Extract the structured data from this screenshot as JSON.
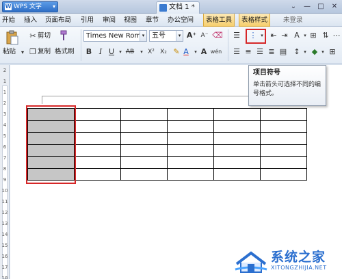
{
  "title_bar": {
    "app_name": "WPS 文字",
    "app_caret": "▾",
    "doc_tab": "文档 1 *",
    "controls": [
      "⌄",
      "—",
      "□",
      "✕"
    ]
  },
  "menu": {
    "items": [
      "开始",
      "插入",
      "页面布局",
      "引用",
      "审阅",
      "视图",
      "章节",
      "办公空间",
      "表格工具",
      "表格样式"
    ],
    "login": "未登录"
  },
  "toolbar": {
    "cut": "剪切",
    "paste": "粘贴",
    "copy": "复制",
    "format_painter": "格式刷",
    "font_name": "Times New Roma",
    "font_size": "五号",
    "bold": "B",
    "italic": "I",
    "underline": "U",
    "strike": "AB",
    "superscript": "X²",
    "subscript": "X₂",
    "font_color": "A",
    "grow_font": "A⁺",
    "shrink_font": "A⁻",
    "wen": "wén",
    "dropdown_caret": "▾"
  },
  "tooltip": {
    "title": "项目符号",
    "body": "单击箭头可选择不同的编号格式。"
  },
  "ruler": {
    "labels": [
      "2",
      "1",
      "1",
      "2",
      "3",
      "4",
      "5",
      "6",
      "7",
      "8",
      "9",
      "10",
      "11",
      "12",
      "13",
      "14",
      "15",
      "16",
      "17",
      "18"
    ]
  },
  "table": {
    "rows": 6,
    "cols": 6,
    "selected_column": 0
  },
  "watermark": {
    "title": "系统之家",
    "url": "XITONGZHIJIA.NET"
  },
  "colors": {
    "highlight": "#d62728",
    "selected_cell": "#c6c6c6",
    "watermark": "#2b6fcf"
  }
}
